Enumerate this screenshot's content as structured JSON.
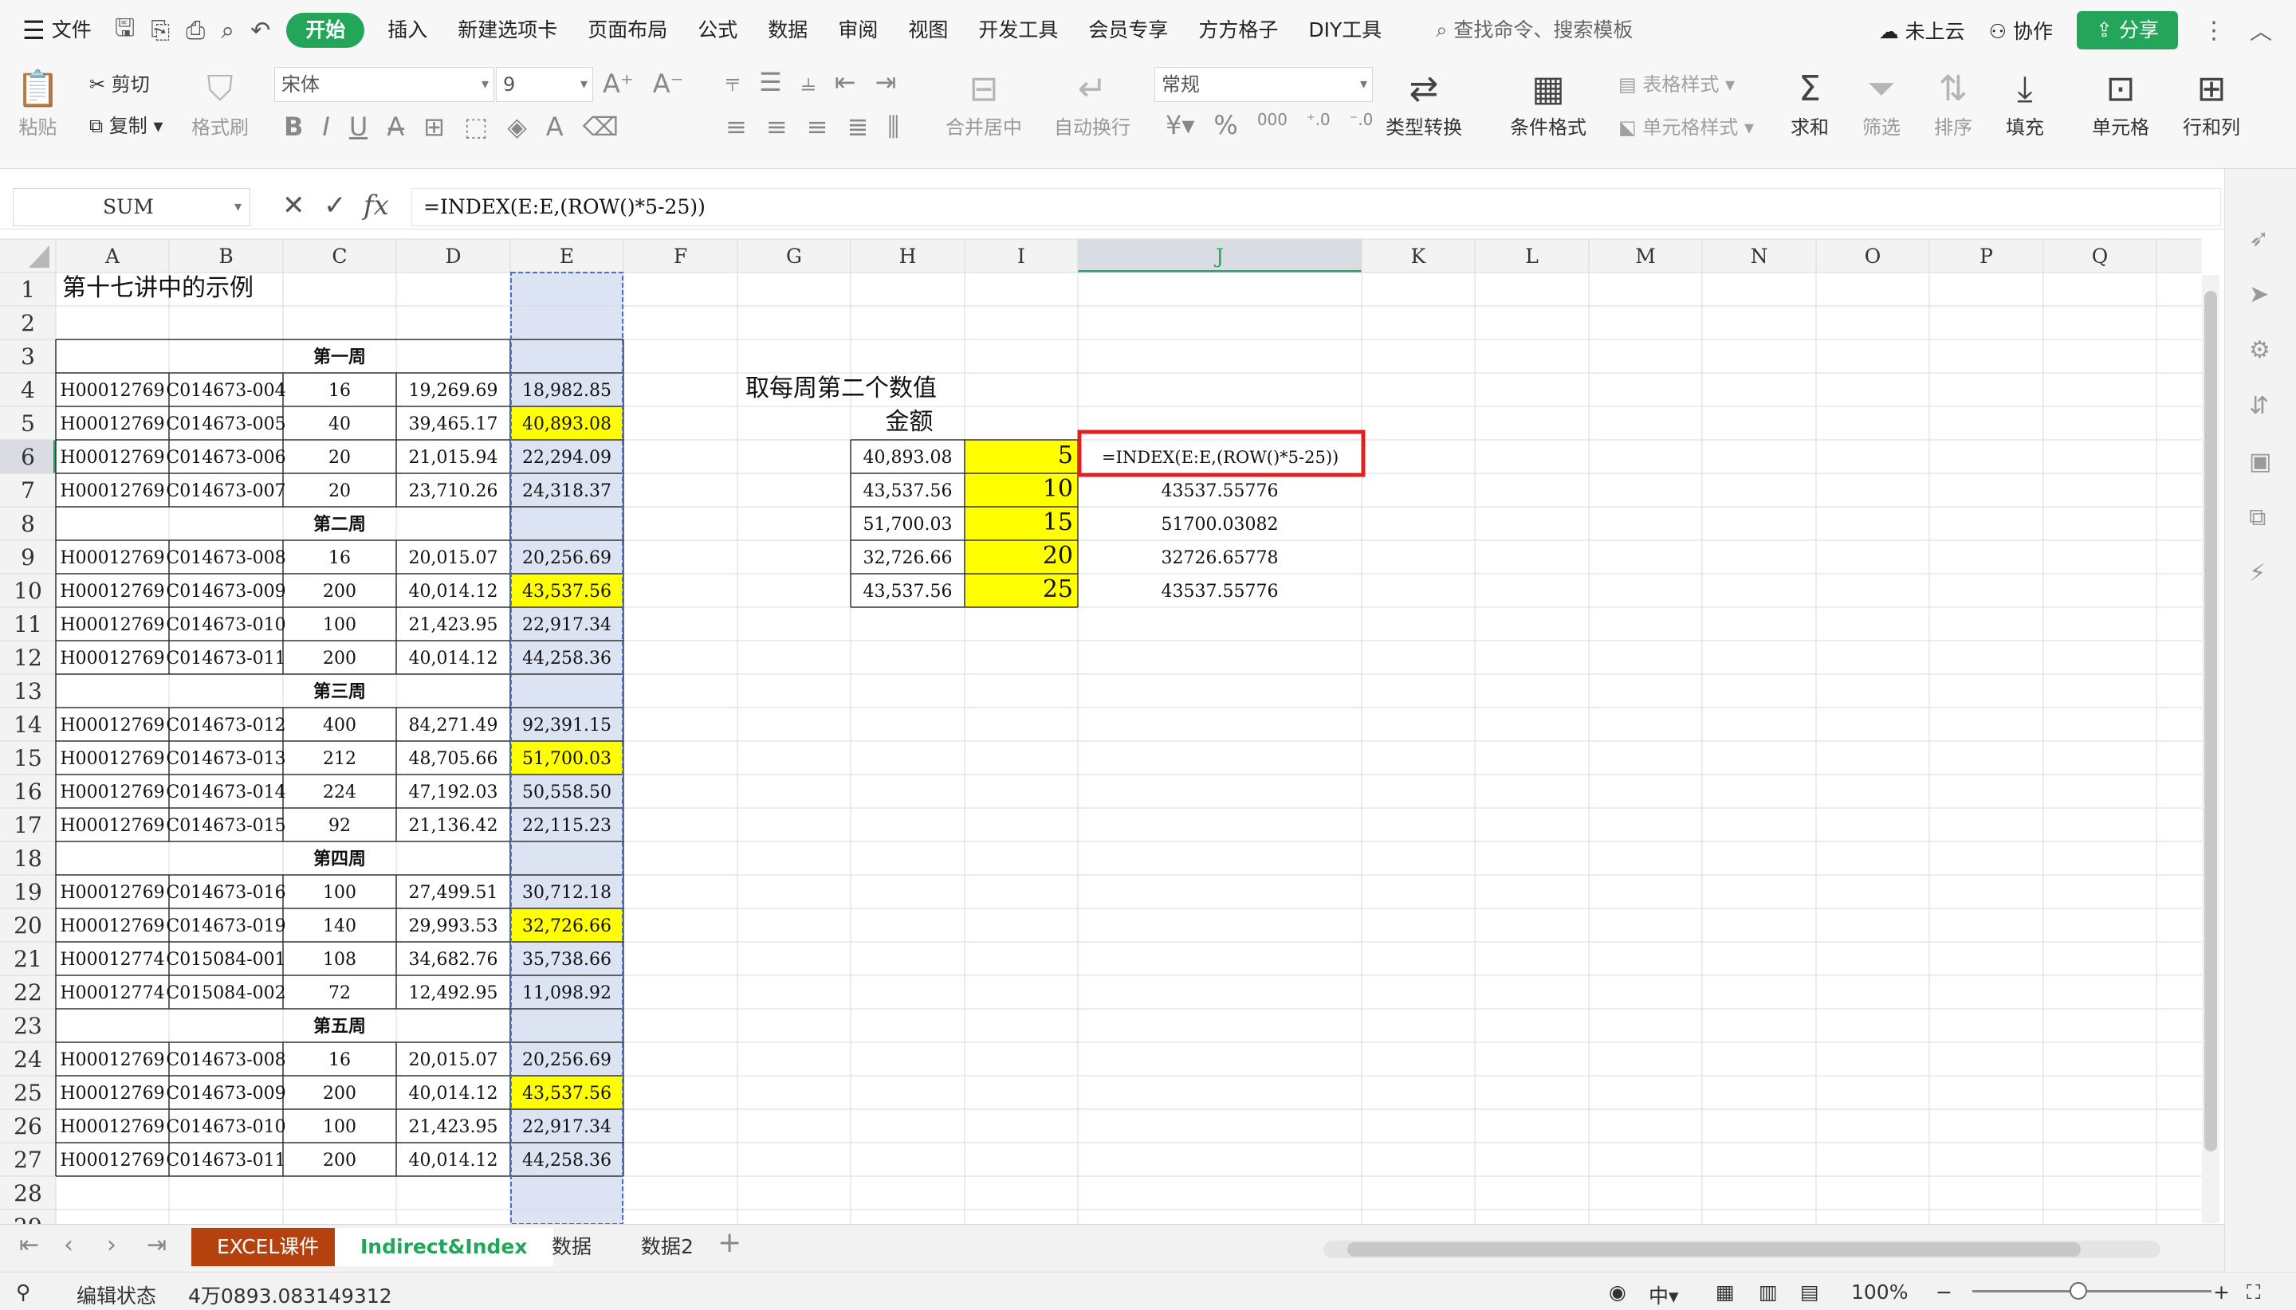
{
  "menu": {
    "file": "文件",
    "start": "开始",
    "items": [
      "插入",
      "新建选项卡",
      "页面布局",
      "公式",
      "数据",
      "审阅",
      "视图",
      "开发工具",
      "会员专享",
      "方方格子",
      "DIY工具"
    ],
    "search": "查找命令、搜索模板",
    "cloud": "未上云",
    "collab": "协作",
    "share": "分享"
  },
  "ribbon": {
    "paste": "粘贴",
    "cut": "剪切",
    "copy": "复制",
    "format_painter": "格式刷",
    "font": "宋体",
    "size": "9",
    "merge": "合并居中",
    "wrap": "自动换行",
    "numfmt": "常规",
    "convert": "类型转换",
    "cond": "条件格式",
    "tablestyle": "表格样式",
    "cellstyle": "单元格样式",
    "sum": "求和",
    "filter": "筛选",
    "sort": "排序",
    "fill": "填充",
    "cell": "单元格",
    "rowcol": "行和列"
  },
  "formula_bar": {
    "name": "SUM",
    "formula": "=INDEX(E:E,(ROW()*5-25))"
  },
  "columns": [
    "A",
    "B",
    "C",
    "D",
    "E",
    "F",
    "G",
    "H",
    "I",
    "J",
    "K",
    "L",
    "M",
    "N",
    "O",
    "P",
    "Q"
  ],
  "cells": {
    "A1": "第十七讲中的示例",
    "C3": "第一周",
    "A4": "H00012769",
    "B4": "C014673-004",
    "C4": "16",
    "D4": "19,269.69",
    "E4": "18,982.85",
    "A5": "H00012769",
    "B5": "C014673-005",
    "C5": "40",
    "D5": "39,465.17",
    "E5": "40,893.08",
    "A6": "H00012769",
    "B6": "C014673-006",
    "C6": "20",
    "D6": "21,015.94",
    "E6": "22,294.09",
    "A7": "H00012769",
    "B7": "C014673-007",
    "C7": "20",
    "D7": "23,710.26",
    "E7": "24,318.37",
    "C8": "第二周",
    "A9": "H00012769",
    "B9": "C014673-008",
    "C9": "16",
    "D9": "20,015.07",
    "E9": "20,256.69",
    "A10": "H00012769",
    "B10": "C014673-009",
    "C10": "200",
    "D10": "40,014.12",
    "E10": "43,537.56",
    "A11": "H00012769",
    "B11": "C014673-010",
    "C11": "100",
    "D11": "21,423.95",
    "E11": "22,917.34",
    "A12": "H00012769",
    "B12": "C014673-011",
    "C12": "200",
    "D12": "40,014.12",
    "E12": "44,258.36",
    "C13": "第三周",
    "A14": "H00012769",
    "B14": "C014673-012",
    "C14": "400",
    "D14": "84,271.49",
    "E14": "92,391.15",
    "A15": "H00012769",
    "B15": "C014673-013",
    "C15": "212",
    "D15": "48,705.66",
    "E15": "51,700.03",
    "A16": "H00012769",
    "B16": "C014673-014",
    "C16": "224",
    "D16": "47,192.03",
    "E16": "50,558.50",
    "A17": "H00012769",
    "B17": "C014673-015",
    "C17": "92",
    "D17": "21,136.42",
    "E17": "22,115.23",
    "C18": "第四周",
    "A19": "H00012769",
    "B19": "C014673-016",
    "C19": "100",
    "D19": "27,499.51",
    "E19": "30,712.18",
    "A20": "H00012769",
    "B20": "C014673-019",
    "C20": "140",
    "D20": "29,993.53",
    "E20": "32,726.66",
    "A21": "H00012774",
    "B21": "C015084-001",
    "C21": "108",
    "D21": "34,682.76",
    "E21": "35,738.66",
    "A22": "H00012774",
    "B22": "C015084-002",
    "C22": "72",
    "D22": "12,492.95",
    "E22": "11,098.92",
    "C23": "第五周",
    "A24": "H00012769",
    "B24": "C014673-008",
    "C24": "16",
    "D24": "20,015.07",
    "E24": "20,256.69",
    "A25": "H00012769",
    "B25": "C014673-009",
    "C25": "200",
    "D25": "40,014.12",
    "E25": "43,537.56",
    "A26": "H00012769",
    "B26": "C014673-010",
    "C26": "100",
    "D26": "21,423.95",
    "E26": "22,917.34",
    "A27": "H00012769",
    "B27": "C014673-011",
    "C27": "200",
    "D27": "40,014.12",
    "E27": "44,258.36",
    "G4": "取每周第二个数值",
    "H5": "金额",
    "H6": "40,893.08",
    "I6": "5",
    "J6": "=INDEX(E:E,(ROW()*5-25))",
    "H7": "43,537.56",
    "I7": "10",
    "J7": "43537.55776",
    "H8": "51,700.03",
    "I8": "15",
    "J8": "51700.03082",
    "H9": "32,726.66",
    "I9": "20",
    "J9": "32726.65778",
    "H10": "43,537.56",
    "I10": "25",
    "J10": "43537.55776"
  },
  "highlight_cells": [
    "E5",
    "E10",
    "E15",
    "E20",
    "E25",
    "I6",
    "I7",
    "I8",
    "I9",
    "I10"
  ],
  "colors": {
    "accent": "#23a65a",
    "yellow": "#ffff00",
    "selcol": "#dce4f4",
    "excel_tab": "#b5410f",
    "edit_border": "#e02020"
  },
  "sheets": [
    "EXCEL课件",
    "Indirect&Index",
    "数据",
    "数据2"
  ],
  "status": {
    "mode": "编辑状态",
    "value": "4万0893.083149312",
    "zoom": "100%"
  }
}
